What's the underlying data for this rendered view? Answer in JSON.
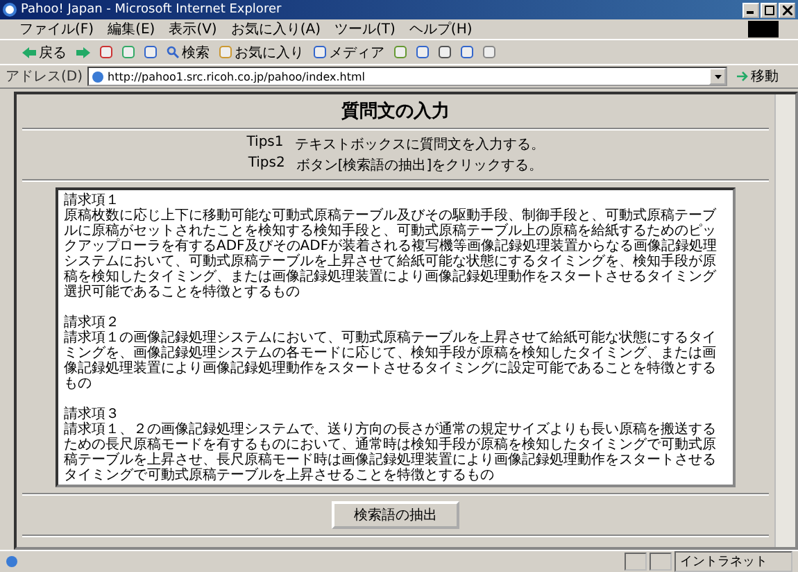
{
  "window": {
    "title": "Pahoo! Japan - Microsoft Internet Explorer"
  },
  "menu": [
    "ファイル(F)",
    "編集(E)",
    "表示(V)",
    "お気に入り(A)",
    "ツール(T)",
    "ヘルプ(H)"
  ],
  "toolbar": [
    {
      "kind": "back",
      "label": "戻る"
    },
    {
      "kind": "forward"
    },
    {
      "kind": "stop"
    },
    {
      "kind": "refresh"
    },
    {
      "kind": "home"
    },
    {
      "kind": "search",
      "label": "検索"
    },
    {
      "kind": "favorites",
      "label": "お気に入り"
    },
    {
      "kind": "media",
      "label": "メディア"
    },
    {
      "kind": "history"
    },
    {
      "kind": "mail"
    },
    {
      "kind": "print"
    },
    {
      "kind": "edit"
    },
    {
      "kind": "note"
    }
  ],
  "address": {
    "label": "アドレス(D)",
    "url": "http://pahoo1.src.ricoh.co.jp/pahoo/index.html",
    "go": "移動"
  },
  "page": {
    "heading": "質問文の入力",
    "tips": [
      {
        "label": "Tips1",
        "text": "テキストボックスに質問文を入力する。"
      },
      {
        "label": "Tips2",
        "text": "ボタン[検索語の抽出]をクリックする。"
      }
    ],
    "question": [
      {
        "title": "請求項１",
        "text": "原稿枚数に応じ上下に移動可能な可動式原稿テーブル及びその駆動手段、制御手段と、可動式原稿テーブルに原稿がセットされたことを検知する検知手段と、可動式原稿テーブル上の原稿を給紙するためのピックアップローラを有するADF及びそのADFが装着される複写機等画像記録処理装置からなる画像記録処理システムにおいて、可動式原稿テーブルを上昇させて給紙可能な状態にするタイミングを、検知手段が原稿を検知したタイミング、または画像記録処理装置により画像記録処理動作をスタートさせるタイミング選択可能であることを特徴とするもの"
      },
      {
        "title": "請求項２",
        "text": "請求項１の画像記録処理システムにおいて、可動式原稿テーブルを上昇させて給紙可能な状態にするタイミングを、画像記録処理システムの各モードに応じて、検知手段が原稿を検知したタイミング、または画像記録処理装置により画像記録処理動作をスタートさせるタイミングに設定可能であることを特徴とするもの"
      },
      {
        "title": "請求項３",
        "text": "請求項１、２の画像記録処理システムで、送り方向の長さが通常の規定サイズよりも長い原稿を搬送するための長尺原稿モードを有するものにおいて、通常時は検知手段が原稿を検知したタイミングで可動式原稿テーブルを上昇させ、長尺原稿モード時は画像記録処理装置により画像記録処理動作をスタートさせるタイミングで可動式原稿テーブルを上昇させることを特徴とするもの"
      }
    ],
    "button": "検索語の抽出"
  },
  "status_bar": {
    "zone": "イントラネット"
  }
}
